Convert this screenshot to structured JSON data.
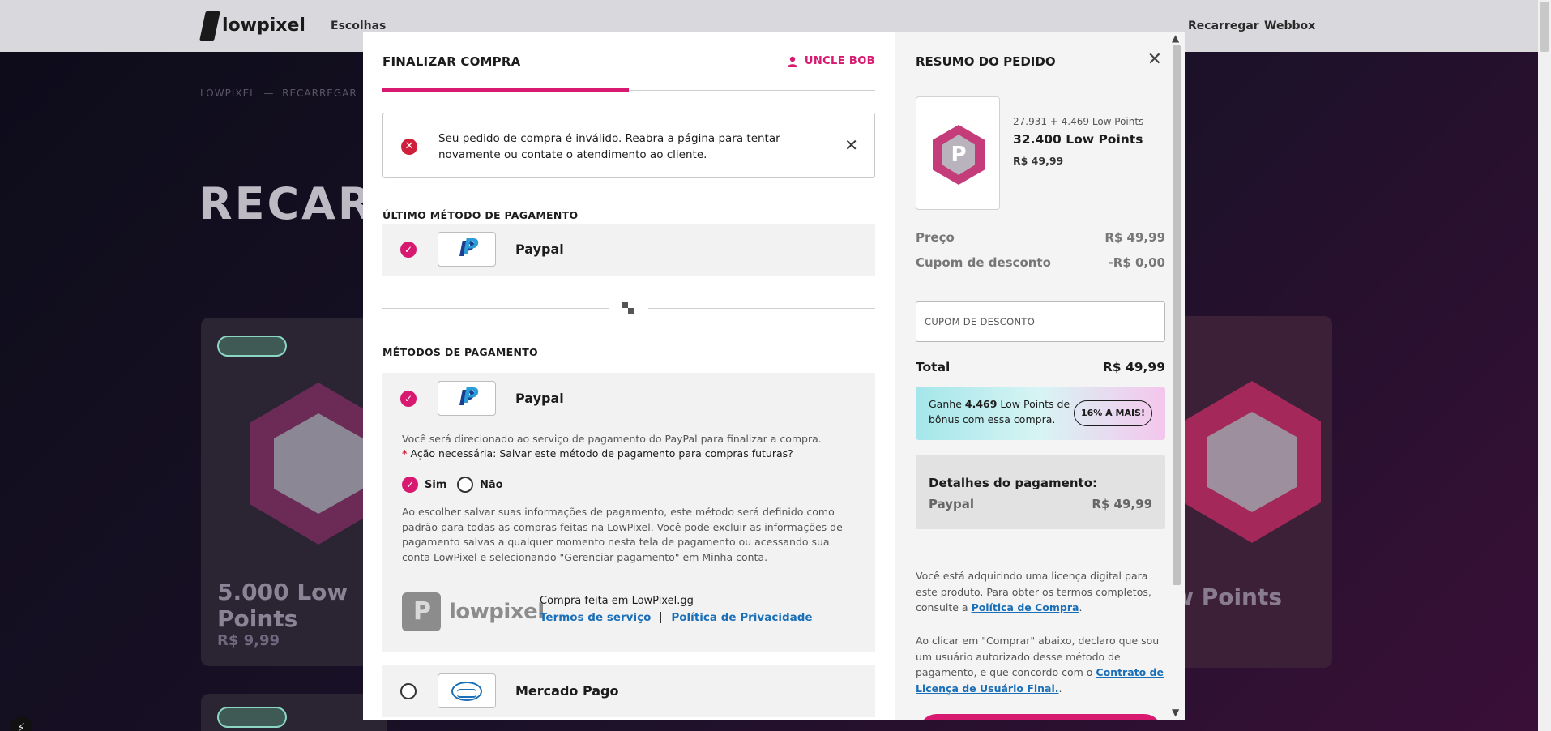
{
  "background": {
    "logo": "lowpixel",
    "nav_left": "Escolhas",
    "nav_right": [
      "Recarregar",
      "Webbox"
    ],
    "breadcrumbs": [
      "LOWPIXEL",
      "RECARREGAR"
    ],
    "page_title": "RECARREGAR",
    "cards": [
      {
        "badge": "",
        "name": "5.000 Low Points",
        "price": "R$ 9,99"
      },
      {
        "badge": "",
        "name": "Low Points",
        "price": ""
      }
    ]
  },
  "checkout": {
    "title": "FINALIZAR COMPRA",
    "user": "UNCLE BOB",
    "step_progress": 0.5,
    "alert": {
      "message": "Seu pedido de compra é inválido. Reabra a página para tentar novamente ou contate o atendimento ao cliente."
    },
    "last_method_label": "ÚLTIMO MÉTODO DE PAGAMENTO",
    "last_method": {
      "name": "Paypal",
      "selected": true
    },
    "methods_label": "MÉTODOS DE PAGAMENTO",
    "paypal": {
      "name": "Paypal",
      "selected": true,
      "redirect_text": "Você será direcionado ao serviço de pagamento do PayPal para finalizar a compra.",
      "required_star": "*",
      "required_text": "Ação necessária: Salvar este método de pagamento para compras futuras?",
      "option_yes": "Sim",
      "option_no": "Não",
      "selected_option": "Sim",
      "save_info": "Ao escolher salvar suas informações de pagamento, este método será definido como padrão para todas as compras feitas na LowPixel. Você pode excluir as informações de pagamento salvas a qualquer momento nesta tela de pagamento ou acessando sua conta LowPixel e selecionando \"Gerenciar pagamento\" em Minha conta.",
      "brand_word": "lowpixel",
      "purchase_at": "Compra feita em LowPixel.gg",
      "terms_link": "Termos de serviço",
      "privacy_link": "Política de Privacidade"
    },
    "mercadopago": {
      "name": "Mercado Pago",
      "selected": false
    }
  },
  "summary": {
    "title": "RESUMO DO PEDIDO",
    "product": {
      "subtitle": "27.931 + 4.469 Low Points",
      "name": "32.400 Low Points",
      "price": "R$ 49,99"
    },
    "price_label": "Preço",
    "price_value": "R$ 49,99",
    "discount_label": "Cupom de desconto",
    "discount_value": "-R$ 0,00",
    "coupon_placeholder": "CUPOM DE DESCONTO",
    "total_label": "Total",
    "total_value": "R$ 49,99",
    "bonus": {
      "prefix": "Ganhe",
      "amount": "4.469",
      "suffix": "Low Points de bônus com essa compra.",
      "percent": "16% A MAIS!"
    },
    "payment_details": {
      "title": "Detalhes do pagamento:",
      "method": "Paypal",
      "amount": "R$ 49,99"
    },
    "license_note": "Você está adquirindo uma licença digital para este produto. Para obter os termos completos, consulte a",
    "purchase_policy_link": "Política de Compra",
    "consent_note": "Ao clicar em \"Comprar\" abaixo, declaro que sou um usuário autorizado desse método de pagamento, e que concordo com o",
    "eula_link": "Contrato de Licença de Usuário Final."
  },
  "colors": {
    "accent": "#d7196f",
    "link": "#1a6fb8",
    "error": "#d01f3a",
    "paypal_dark": "#1a3f8f",
    "paypal_light": "#2a9cd8"
  }
}
